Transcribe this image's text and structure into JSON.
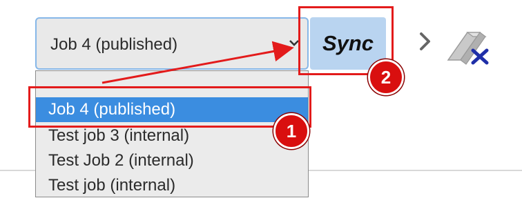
{
  "select": {
    "value": "Job 4 (published)"
  },
  "dropdown": {
    "options": [
      {
        "label": "Job 4 (published)",
        "selected": true
      },
      {
        "label": "Test job 3 (internal)",
        "selected": false
      },
      {
        "label": "Test Job 2 (internal)",
        "selected": false
      },
      {
        "label": "Test job (internal)",
        "selected": false
      }
    ]
  },
  "toolbar": {
    "sync_label": "Sync"
  },
  "annotations": {
    "badge_1": "1",
    "badge_2": "2",
    "color": "#e31b1b"
  },
  "colors": {
    "selected_option": "#3b8de0",
    "sync_button": "#b9d4f0",
    "select_focus_border": "#86b7e8",
    "clear_icon": "#1f2fa8"
  }
}
